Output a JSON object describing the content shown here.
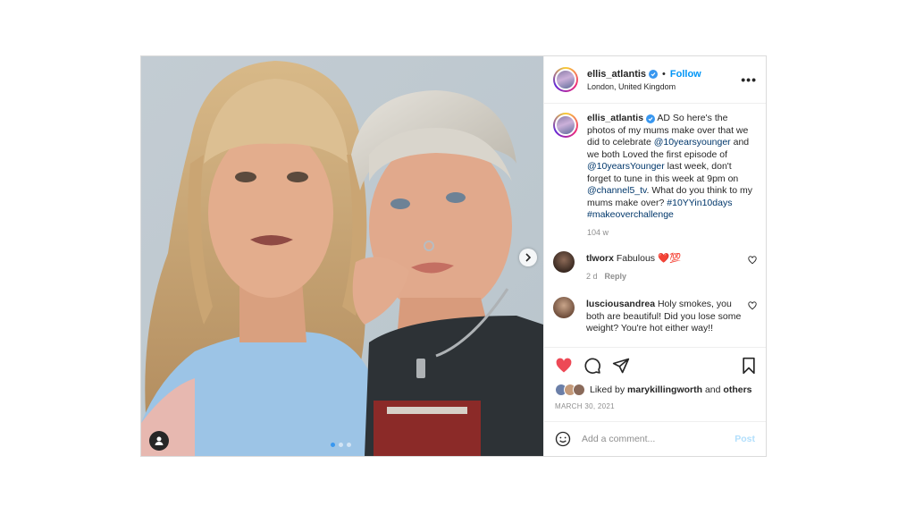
{
  "post": {
    "author": "ellis_atlantis",
    "follow_label": "Follow",
    "separator": "•",
    "location": "London, United Kingdom",
    "more_label": "•••",
    "caption": {
      "username": "ellis_atlantis",
      "text_1": " AD So here's the photos of my mums make over that we did to celebrate ",
      "mention_1": "@10yearsyounger",
      "text_2": " and we both Loved the first episode of ",
      "mention_2": "@10yearsYounger",
      "text_3": " last week, don't forget to tune in this week at 9pm on ",
      "mention_3": "@channel5_tv",
      "text_4": ". What do you think to my mums make over? ",
      "hashtag_1": "#10YYin10days",
      "hashtag_2": "#makeoverchallenge",
      "time": "104 w"
    },
    "comments": [
      {
        "username": "tlworx",
        "text": "Fabulous ❤️💯",
        "time": "2 d",
        "reply_label": "Reply"
      },
      {
        "username": "lusciousandrea",
        "text": "Holy smokes, you both are beautiful! Did you lose some weight? You're hot either way!!"
      }
    ],
    "likes": {
      "prefix": "Liked by ",
      "user": "marykillingworth",
      "middle": " and ",
      "others": "others"
    },
    "date": "MARCH 30, 2021",
    "comment_placeholder": "Add a comment...",
    "post_label": "Post",
    "carousel": {
      "slides": 3,
      "active_index": 0
    },
    "colors": {
      "accent": "#0095f6",
      "like_red": "#ed4956",
      "post_disabled": "#b2dffc"
    }
  }
}
